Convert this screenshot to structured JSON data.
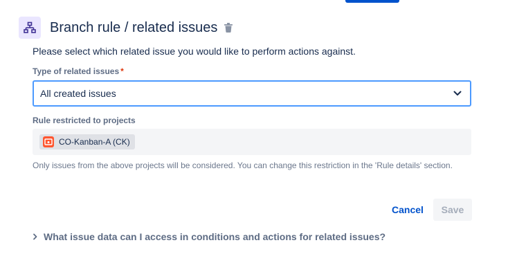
{
  "header": {
    "title": "Branch rule / related issues",
    "icon": "branch-hierarchy-icon",
    "delete_icon": "trash-icon"
  },
  "form": {
    "description": "Please select which related issue you would like to perform actions against.",
    "type_label": "Type of related issues",
    "required_marker": "*",
    "type_value": "All created issues",
    "projects_label": "Rule restricted to projects",
    "project_chip": "CO-Kanban-A (CK)",
    "helper_text": "Only issues from the above projects will be considered. You can change this restriction in the 'Rule details' section."
  },
  "actions": {
    "cancel_label": "Cancel",
    "save_label": "Save"
  },
  "faq": {
    "question": "What issue data can I access in conditions and actions for related issues?"
  },
  "colors": {
    "accent": "#0052cc",
    "focus_border": "#4c9aff",
    "icon_bg": "#eae6ff",
    "icon_fg": "#403294",
    "project_avatar": "#ff5630",
    "required": "#de350b"
  }
}
